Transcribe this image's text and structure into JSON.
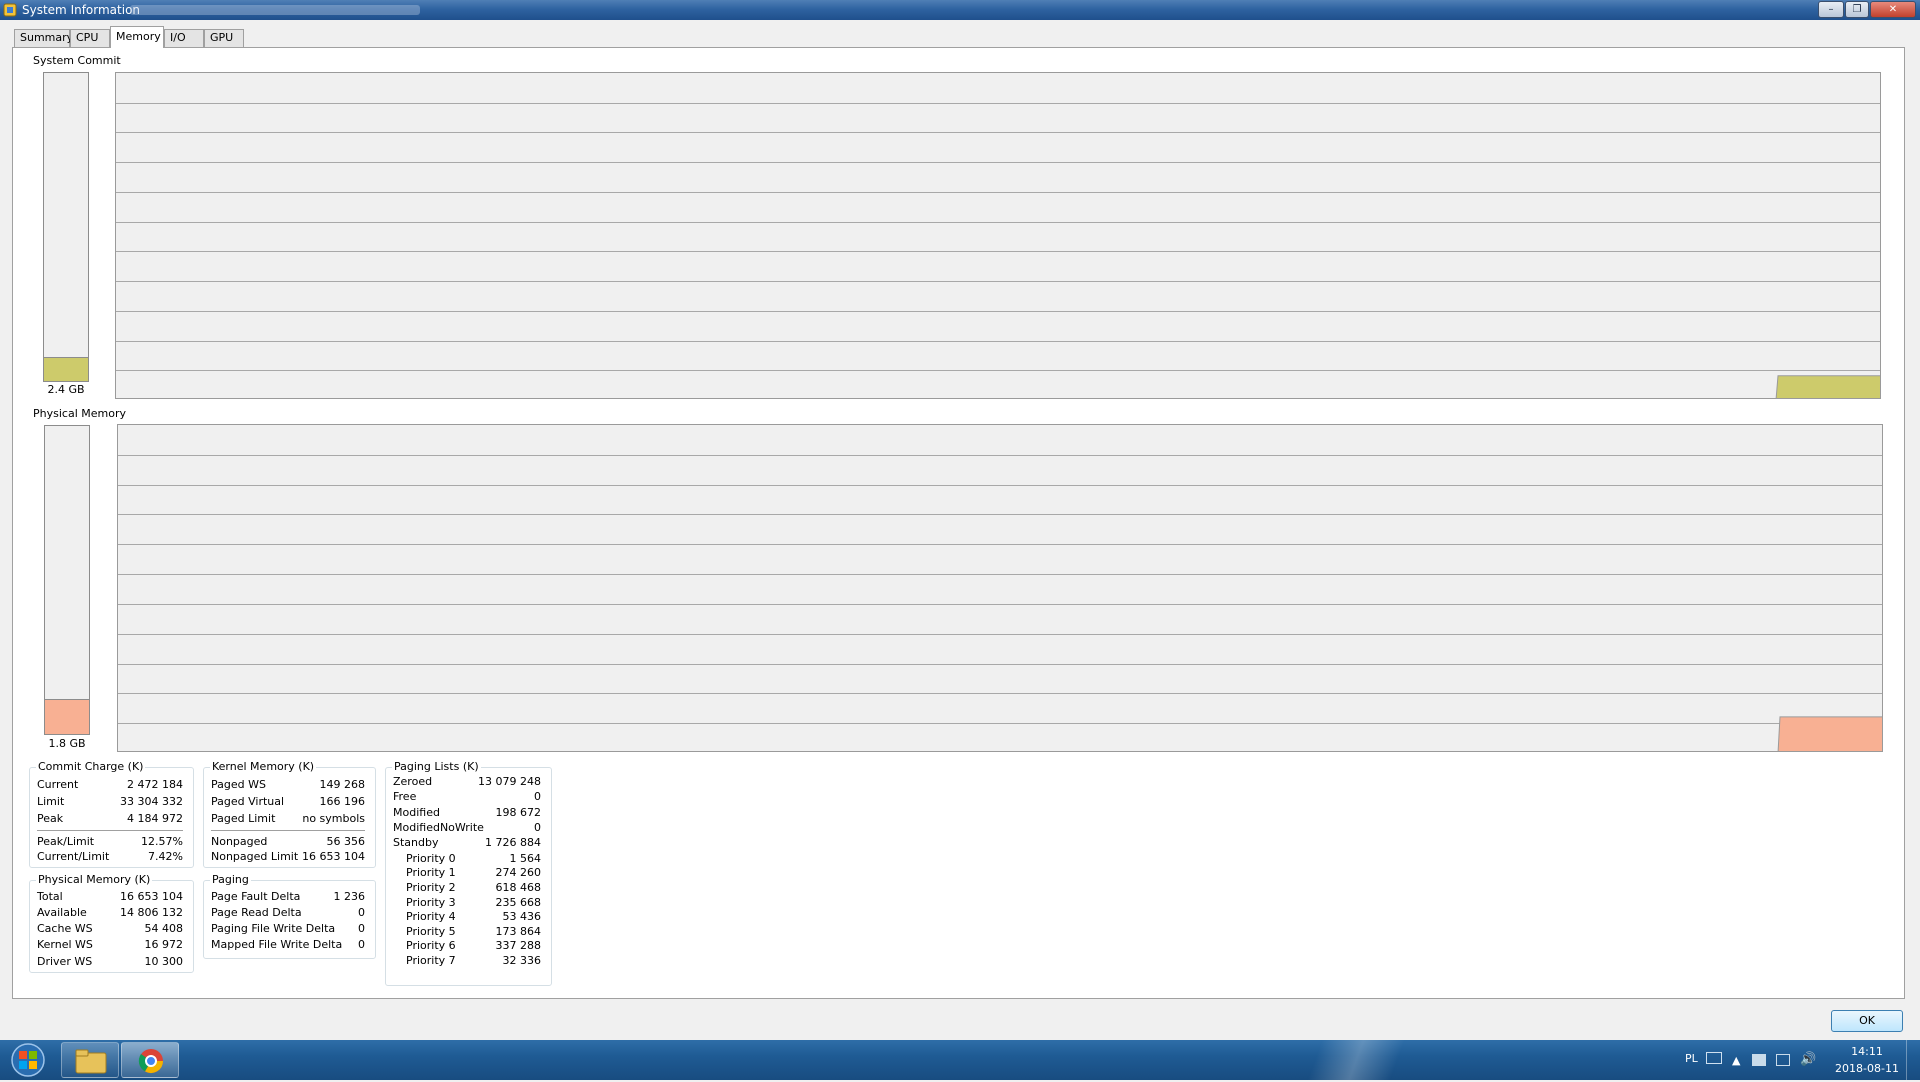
{
  "window": {
    "title": "System Information"
  },
  "tabs": [
    "Summary",
    "CPU",
    "Memory",
    "I/O",
    "GPU"
  ],
  "active_tab": "Memory",
  "system_commit": {
    "label": "System Commit",
    "value_label": "2.4 GB",
    "fill_fraction": 0.074,
    "color": "#cdcb6b"
  },
  "physical_memory_graph": {
    "label": "Physical Memory",
    "value_label": "1.8 GB",
    "fill_fraction": 0.11,
    "color": "#f8b093"
  },
  "commit_charge": {
    "title": "Commit Charge (K)",
    "rows": [
      {
        "k": "Current",
        "v": "2 472 184"
      },
      {
        "k": "Limit",
        "v": "33 304 332"
      },
      {
        "k": "Peak",
        "v": "4 184 972"
      }
    ],
    "ratios": [
      {
        "k": "Peak/Limit",
        "v": "12.57%"
      },
      {
        "k": "Current/Limit",
        "v": "7.42%"
      }
    ]
  },
  "kernel_memory": {
    "title": "Kernel Memory (K)",
    "rows": [
      {
        "k": "Paged WS",
        "v": "149 268"
      },
      {
        "k": "Paged Virtual",
        "v": "166 196"
      },
      {
        "k": "Paged Limit",
        "v": "no symbols"
      }
    ],
    "rows2": [
      {
        "k": "Nonpaged",
        "v": "56 356"
      },
      {
        "k": "Nonpaged Limit",
        "v": "16 653 104"
      }
    ]
  },
  "physical_memory": {
    "title": "Physical Memory (K)",
    "rows": [
      {
        "k": "Total",
        "v": "16 653 104"
      },
      {
        "k": "Available",
        "v": "14 806 132"
      },
      {
        "k": "Cache WS",
        "v": "54 408"
      },
      {
        "k": "Kernel WS",
        "v": "16 972"
      },
      {
        "k": "Driver WS",
        "v": "10 300"
      }
    ]
  },
  "paging": {
    "title": "Paging",
    "rows": [
      {
        "k": "Page Fault Delta",
        "v": "1 236"
      },
      {
        "k": "Page Read Delta",
        "v": "0"
      },
      {
        "k": "Paging File Write Delta",
        "v": "0"
      },
      {
        "k": "Mapped File Write Delta",
        "v": "0"
      }
    ]
  },
  "paging_lists": {
    "title": "Paging Lists (K)",
    "rows": [
      {
        "k": "Zeroed",
        "v": "13 079 248"
      },
      {
        "k": "Free",
        "v": "0"
      },
      {
        "k": "Modified",
        "v": "198 672"
      },
      {
        "k": "ModifiedNoWrite",
        "v": "0"
      },
      {
        "k": "Standby",
        "v": "1 726 884"
      }
    ],
    "priorities": [
      {
        "k": "Priority 0",
        "v": "1 564"
      },
      {
        "k": "Priority 1",
        "v": "274 260"
      },
      {
        "k": "Priority 2",
        "v": "618 468"
      },
      {
        "k": "Priority 3",
        "v": "235 668"
      },
      {
        "k": "Priority 4",
        "v": "53 436"
      },
      {
        "k": "Priority 5",
        "v": "173 864"
      },
      {
        "k": "Priority 6",
        "v": "337 288"
      },
      {
        "k": "Priority 7",
        "v": "32 336"
      }
    ]
  },
  "ok_label": "OK",
  "taskbar": {
    "lang": "PL",
    "time": "14:11",
    "date": "2018-08-11"
  }
}
